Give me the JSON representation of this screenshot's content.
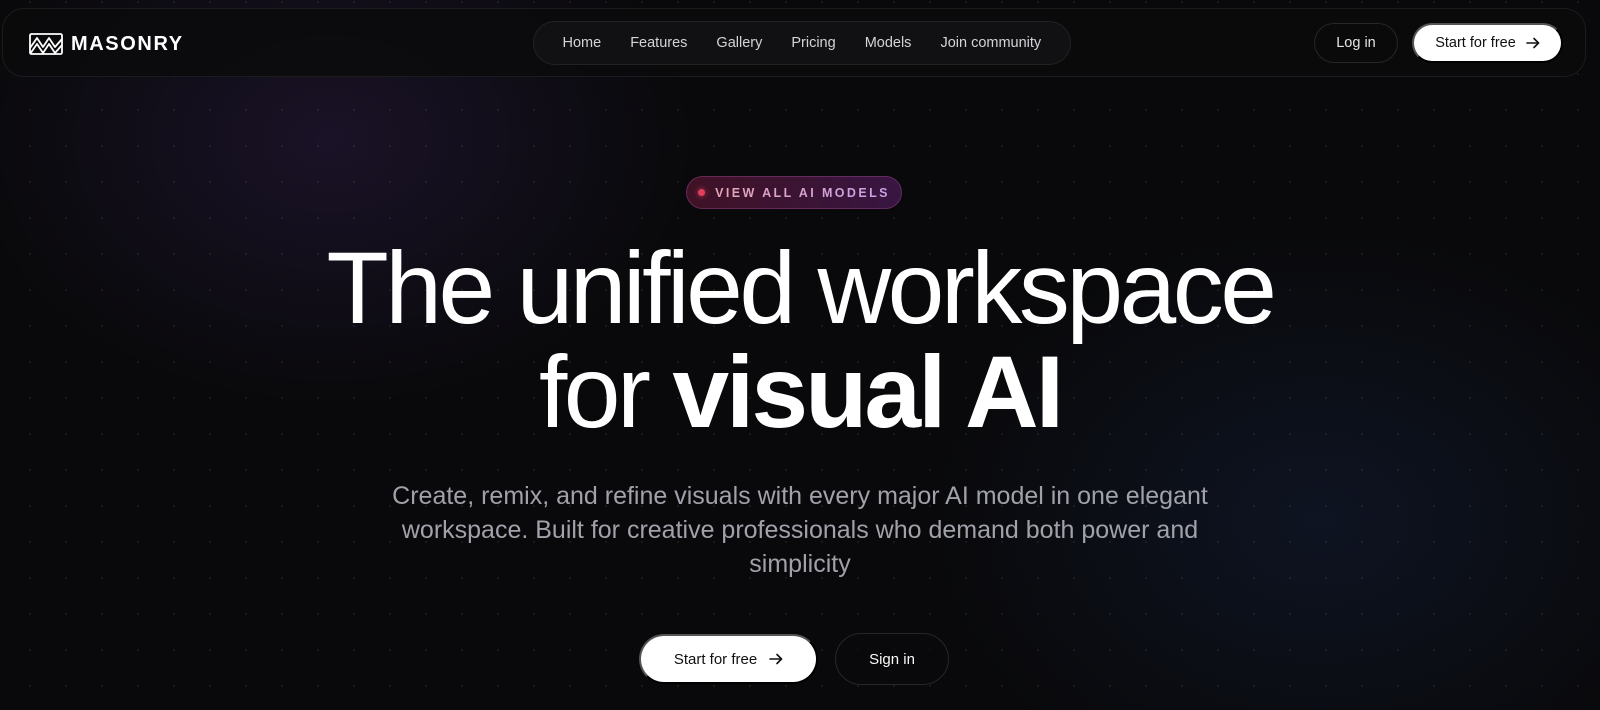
{
  "brand": {
    "name": "MASONRY",
    "logo_icon": "masonry-logo-icon"
  },
  "nav": {
    "links": [
      "Home",
      "Features",
      "Gallery",
      "Pricing",
      "Models",
      "Join community"
    ],
    "login_label": "Log in",
    "start_label": "Start for free"
  },
  "hero": {
    "badge": "VIEW ALL AI MODELS",
    "headline_line1": "The unified workspace",
    "headline_line2_light": "for ",
    "headline_line2_bold": "visual AI",
    "subtitle": "Create, remix, and refine visuals with every major AI model in one elegant workspace. Built for creative professionals who demand both power and simplicity",
    "cta_primary": "Start for free",
    "cta_secondary": "Sign in"
  },
  "colors": {
    "background": "#09090b",
    "text": "#fafafa",
    "muted": "#a1a1aa",
    "badge_dot": "#e0405e",
    "button_bg": "#ffffff"
  }
}
